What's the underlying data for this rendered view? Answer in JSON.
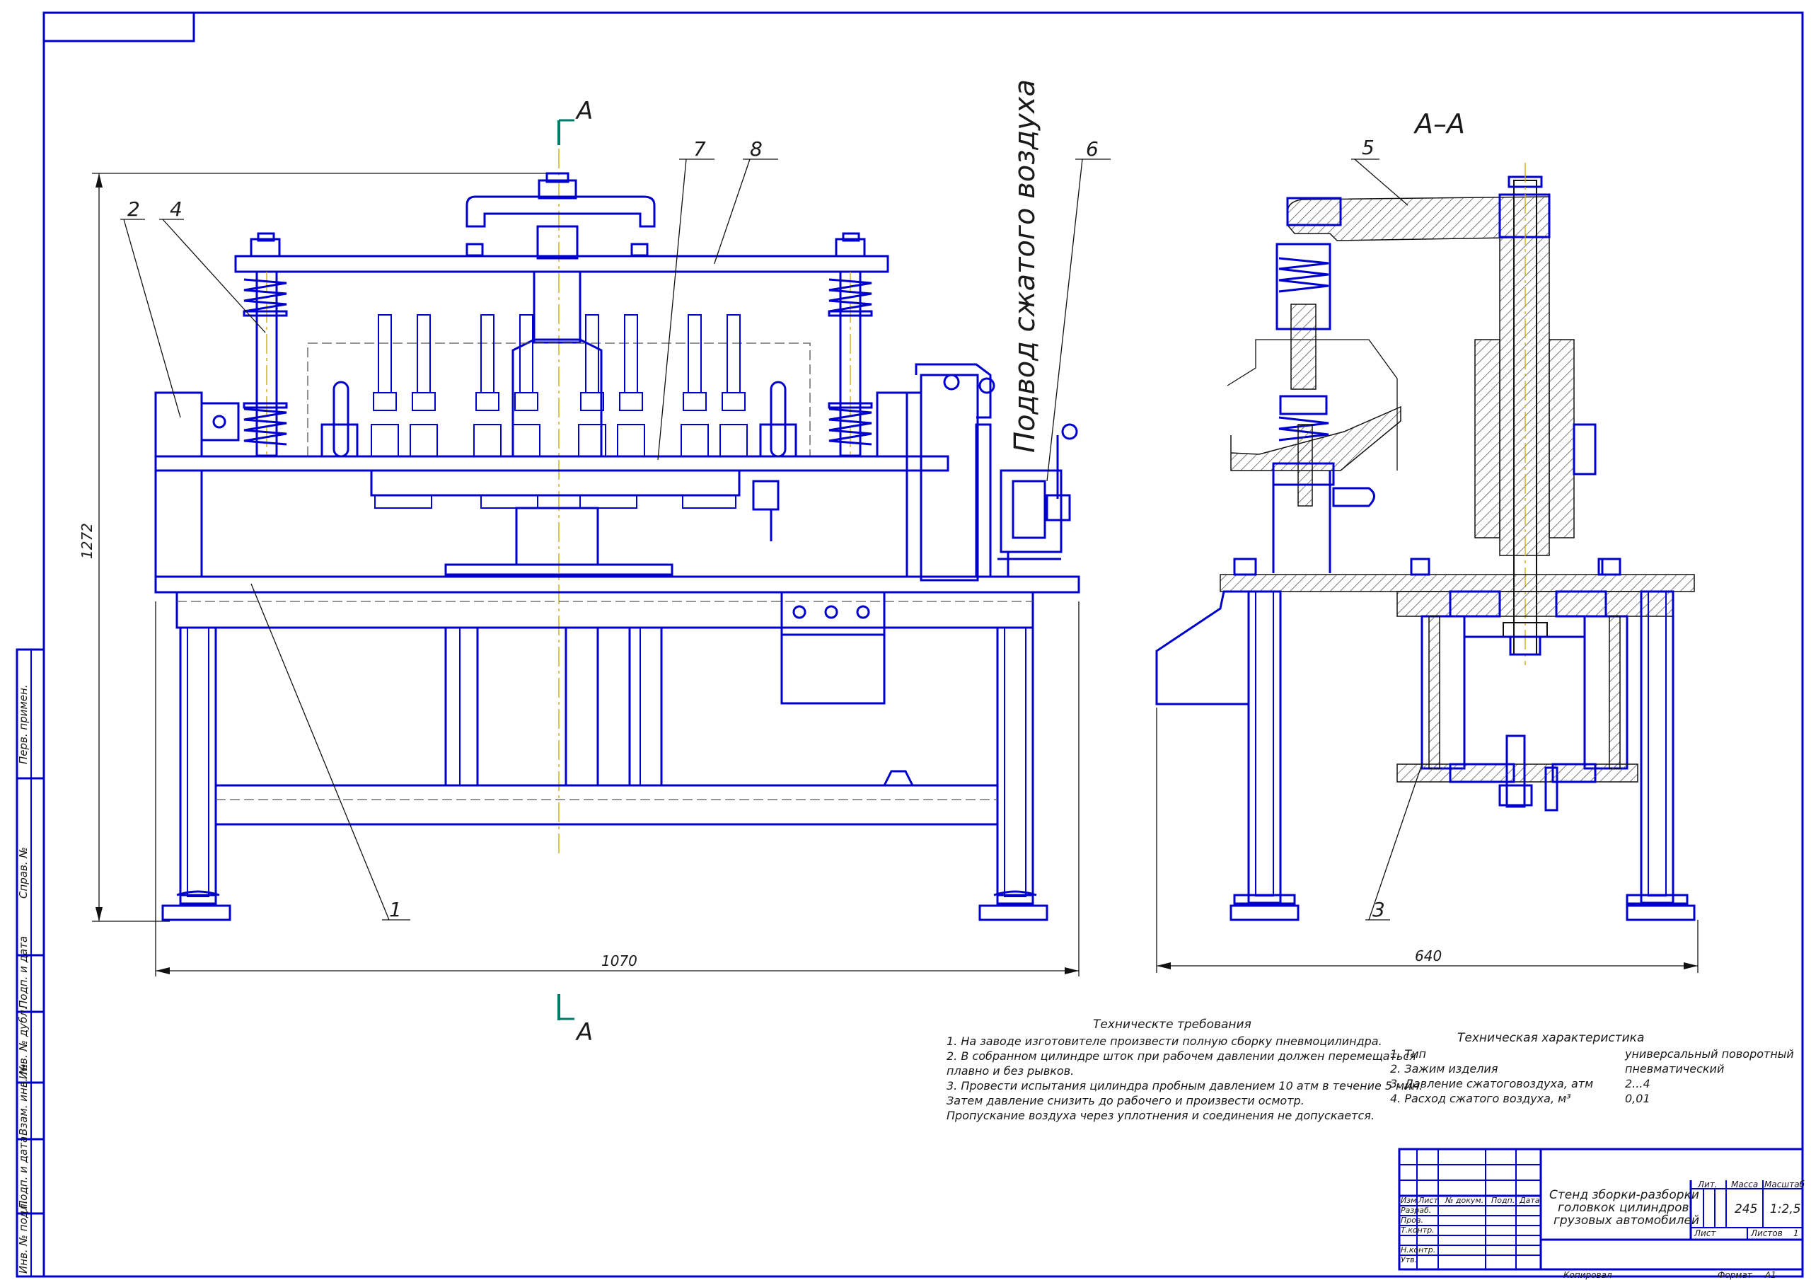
{
  "drawing": {
    "section_mark_letter": "A",
    "section_view_title": "А–А",
    "air_supply_label": "Подвод сжатого воздуха",
    "callouts": [
      "1",
      "2",
      "3",
      "4",
      "5",
      "6",
      "7",
      "8"
    ],
    "dimensions": {
      "height": "1272",
      "width_front": "1070",
      "width_section": "640"
    }
  },
  "technical_requirements": {
    "title": "Техническте требования",
    "lines": [
      "1. На заводе изготовителе произвести полную сборку пневмоцилиндра.",
      "2. В собранном цилиндре шток при рабочем давлении должен перемещаться",
      "плавно и без рывков.",
      "3. Провести  испытания цилиндра пробным давлением 10 атм в течение 5 мин.",
      " Затем давление снизить до рабочего и произвести осмотр.",
      " Пропускание воздуха через уплотнения и соединения не допускается."
    ]
  },
  "technical_characteristics": {
    "title": "Техническая характеристика",
    "rows": [
      {
        "label": "1. Тип",
        "value": "универсальный поворотный"
      },
      {
        "label": "2. Зажим изделия",
        "value": "пневматический"
      },
      {
        "label": "3. Давление сжатоговоздуха, атм",
        "value": "2...4"
      },
      {
        "label": "4. Расход сжатого воздуха, м³",
        "value": "0,01"
      }
    ]
  },
  "title_block": {
    "name_lines": [
      "Стенд зборки-разборки",
      "головкок цилиндров",
      "грузовых автомобилей"
    ],
    "header_cols": [
      "Изм.",
      "Лист",
      "№ докум.",
      "Подп.",
      "Дата"
    ],
    "row_labels": [
      "Разраб.",
      "Пров.",
      "Т.контр.",
      "",
      "Н.контр.",
      "Утв."
    ],
    "lit_label": "Лит.",
    "mass_label": "Масса",
    "scale_label": "Масштаб",
    "mass_value": "245",
    "scale_value": "1:2,5",
    "sheet_label": "Лист",
    "sheet_value": "",
    "sheets_label": "Листов",
    "sheets_value": "1",
    "copied_label": "Копировал",
    "format_label": "Формат",
    "format_value": "A1"
  },
  "side_strip": {
    "labels": [
      "Перв. примен.",
      "Справ. №",
      "Подп. и дата",
      "Инв. № дубл.",
      "Взам. инв. №",
      "Подп. и дата",
      "Инв. № подл."
    ]
  },
  "colors": {
    "outline": "#0000cc",
    "ink": "#111111",
    "hatch": "#444444",
    "axis": "#c8a800",
    "section_marker": "#007a6a"
  }
}
